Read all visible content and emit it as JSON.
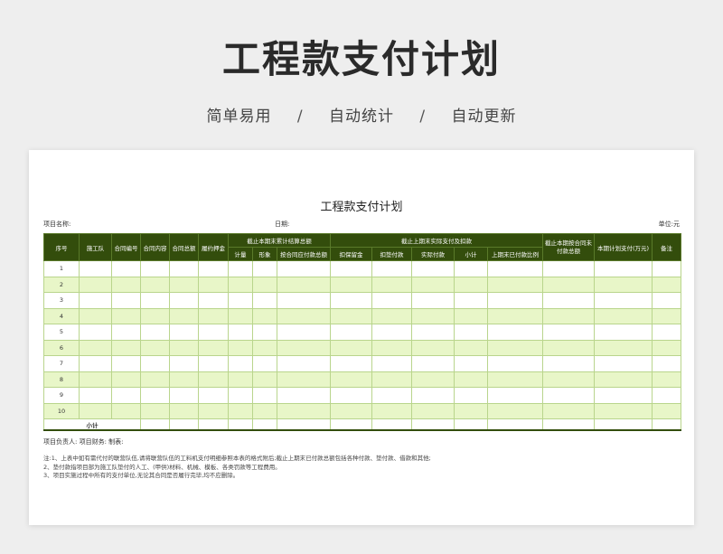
{
  "hero": {
    "title": "工程款支付计划",
    "features": [
      "简单易用",
      "自动统计",
      "自动更新"
    ],
    "separator": "/"
  },
  "doc": {
    "title": "工程款支付计划",
    "project_label": "项目名称:",
    "date_label": "日期:",
    "unit_label": "单位:元"
  },
  "table": {
    "headers": {
      "seq": "序号",
      "team": "施工队",
      "contract_no": "合同编号",
      "contract_content": "合同内容",
      "contract_total": "合同总额",
      "deposit": "履约押金",
      "group_settle": "截止本期末累计结算总额",
      "group_paid": "截止上期末实际支付及扣款",
      "due_by_contract": "截止本期按合同未付款总额",
      "plan_pay": "本期计划支付(万元)",
      "remark": "备注",
      "settle_sub": [
        "计量",
        "形象",
        "按合同应付款总额"
      ],
      "paid_sub": [
        "扣保留金",
        "扣垫付款",
        "实际付款",
        "小计",
        "上期末已付款比例"
      ]
    },
    "rows": [
      "1",
      "2",
      "3",
      "4",
      "5",
      "6",
      "7",
      "8",
      "9",
      "10"
    ],
    "subtotal_label": "小计"
  },
  "footer": {
    "signatures": "项目负责人:  项目财务:  制表:",
    "notes": [
      "注:1、上表中如有需代付的联营队伍,请将联营队伍的工料机支付明细参照本表的格式附后;截止上期末已付款总额包括各种付款、垫付款、借款和其他;",
      "2、垫付款指项目部为施工队垫付的人工、(甲供)材料、机械、模板、各类罚款等工程费用。",
      "3、项目实施过程中所有的支付单位,无论其合同是否履行完毕,均不应删除。"
    ]
  }
}
